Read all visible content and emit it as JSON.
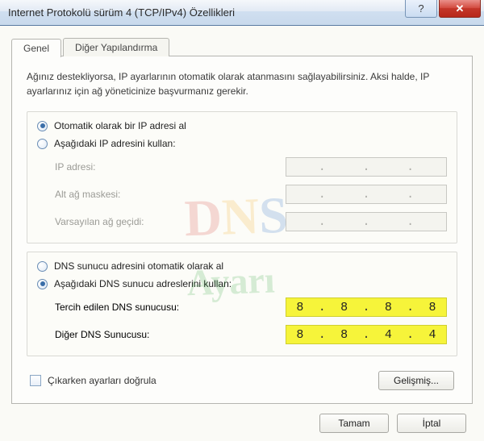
{
  "window": {
    "title": "Internet Protokolü sürüm 4 (TCP/IPv4) Özellikleri"
  },
  "tabs": {
    "general": "Genel",
    "alternate": "Diğer Yapılandırma"
  },
  "description": "Ağınız destekliyorsa, IP ayarlarının otomatik olarak atanmasını sağlayabilirsiniz. Aksi halde, IP ayarlarınız için ağ yöneticinize başvurmanız gerekir.",
  "ip_group": {
    "auto_label": "Otomatik olarak bir IP adresi al",
    "manual_label": "Aşağıdaki IP adresini kullan:",
    "ip_label": "IP adresi:",
    "mask_label": "Alt ağ maskesi:",
    "gateway_label": "Varsayılan ağ geçidi:"
  },
  "dns_group": {
    "auto_label": "DNS sunucu adresini otomatik olarak al",
    "manual_label": "Aşağıdaki DNS sunucu adreslerini kullan:",
    "preferred_label": "Tercih edilen DNS sunucusu:",
    "alternate_label": "Diğer DNS Sunucusu:",
    "preferred": {
      "o1": "8",
      "o2": "8",
      "o3": "8",
      "o4": "8"
    },
    "alternate": {
      "o1": "8",
      "o2": "8",
      "o3": "4",
      "o4": "4"
    }
  },
  "validate_label": "Çıkarken ayarları doğrula",
  "buttons": {
    "advanced": "Gelişmiş...",
    "ok": "Tamam",
    "cancel": "İptal"
  },
  "watermark": {
    "line1": "DNS",
    "line2": "Ayarı"
  }
}
